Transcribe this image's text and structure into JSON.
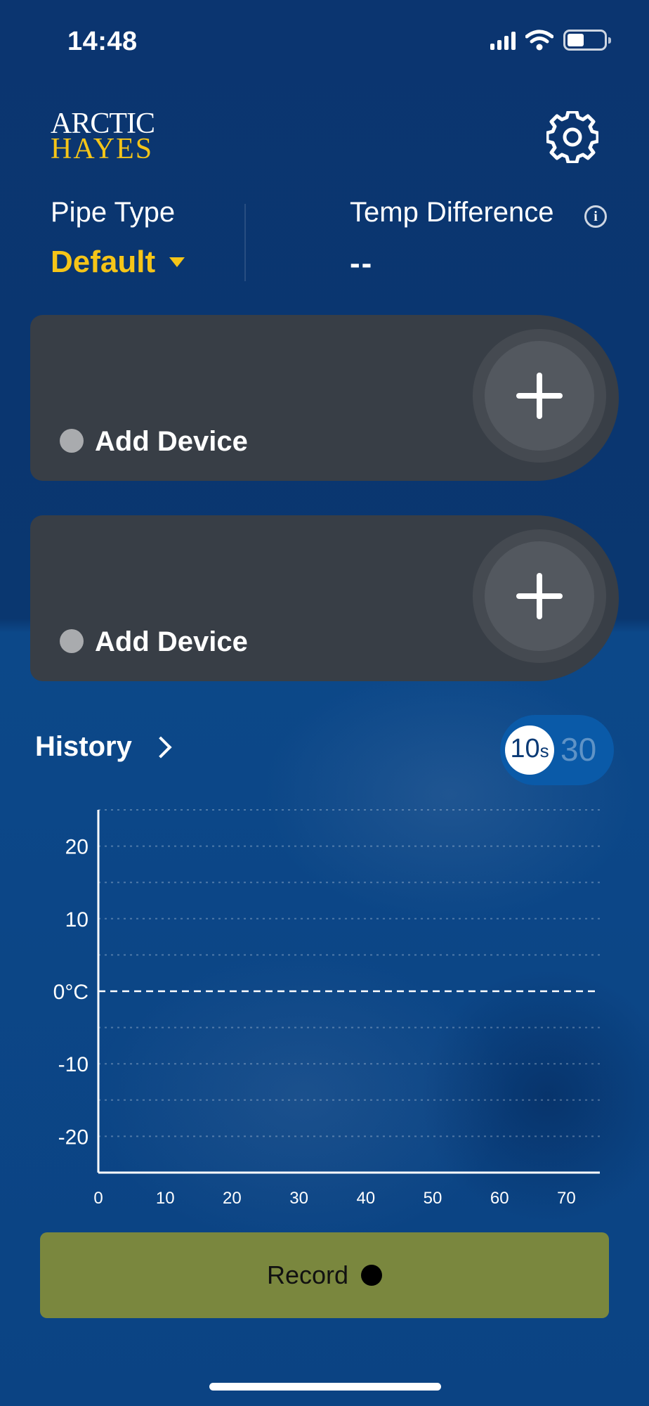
{
  "status_bar": {
    "time": "14:48"
  },
  "header": {
    "logo_line1": "ARCTIC",
    "logo_line2": "HAYES"
  },
  "pipe": {
    "label": "Pipe Type",
    "value": "Default"
  },
  "temp": {
    "label": "Temp Difference",
    "value": "--",
    "info": "i"
  },
  "devices": [
    {
      "label": "Add Device",
      "status_color": "#a9abae"
    },
    {
      "label": "Add Device",
      "status_color": "#a9abae"
    }
  ],
  "history": {
    "title": "History",
    "interval_options": [
      {
        "value": "10",
        "unit": "s",
        "selected": true
      },
      {
        "value": "30",
        "unit": "",
        "selected": false
      }
    ]
  },
  "chart_data": {
    "type": "line",
    "x_ticks": [
      "0",
      "10",
      "20",
      "30",
      "40",
      "50",
      "60",
      "70"
    ],
    "y_ticks": [
      "20",
      "10",
      "0°C",
      "-10",
      "-20"
    ],
    "xlim": [
      0,
      75
    ],
    "ylim": [
      -25,
      25
    ],
    "grid": true,
    "zero_line": "dashed",
    "series": []
  },
  "record": {
    "label": "Record"
  },
  "colors": {
    "accent": "#f5c518",
    "card": "#383e46",
    "record_button": "#7a873e",
    "background": "#0b3a75"
  }
}
